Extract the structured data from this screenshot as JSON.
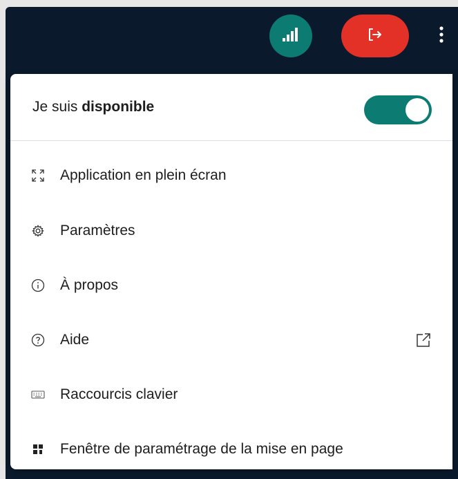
{
  "header": {
    "signal_icon": "signal-bars-icon",
    "leave_icon": "leave-icon",
    "more_icon": "more-vertical-icon",
    "colors": {
      "bar": "#0a1a2c",
      "signal": "#0c7b72",
      "leave": "#e43128"
    }
  },
  "menu": {
    "status": {
      "prefix": "Je suis ",
      "state": "disponible",
      "toggle_on": true,
      "toggle_color": "#0c7b72"
    },
    "items": [
      {
        "label": "Application en plein écran",
        "icon": "fullscreen-icon"
      },
      {
        "label": "Paramètres",
        "icon": "gear-icon"
      },
      {
        "label": "À propos",
        "icon": "info-icon"
      },
      {
        "label": "Aide",
        "icon": "help-icon",
        "external_icon": "external-link-icon"
      },
      {
        "label": "Raccourcis clavier",
        "icon": "keyboard-icon"
      },
      {
        "label": "Fenêtre de paramétrage de la mise en page",
        "icon": "layout-icon"
      }
    ]
  }
}
